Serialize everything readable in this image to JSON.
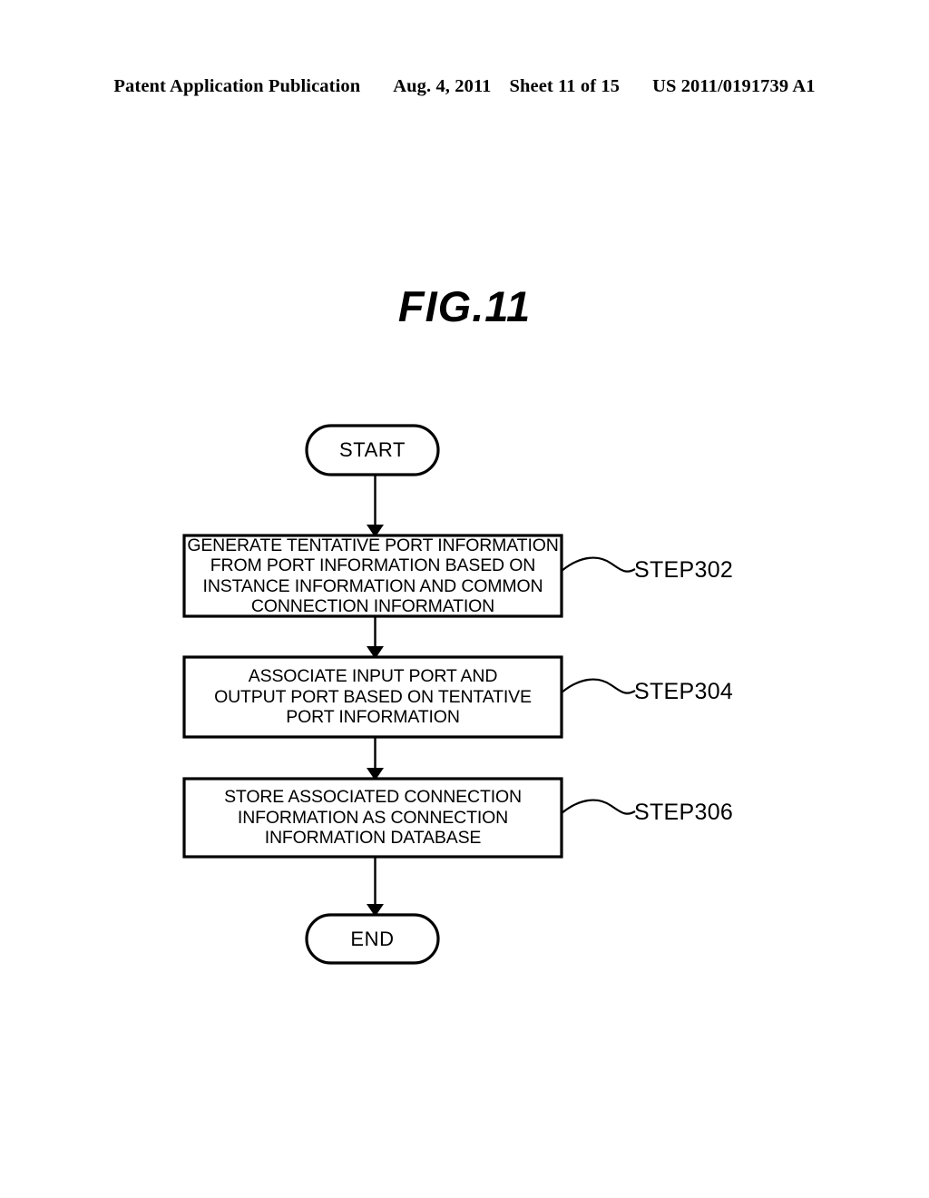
{
  "header": {
    "publication": "Patent Application Publication",
    "date": "Aug. 4, 2011",
    "sheet": "Sheet 11 of 15",
    "publication_number": "US 2011/0191739 A1"
  },
  "figure": {
    "title": "FIG.11"
  },
  "flowchart": {
    "type": "flowchart",
    "orientation": "top-to-bottom",
    "nodes": [
      {
        "id": "start",
        "shape": "terminal",
        "label": "START"
      },
      {
        "id": "step302",
        "shape": "process",
        "step": "STEP302",
        "lines": [
          "GENERATE TENTATIVE PORT INFORMATION",
          "FROM PORT INFORMATION BASED ON",
          "INSTANCE INFORMATION AND COMMON",
          "CONNECTION INFORMATION"
        ]
      },
      {
        "id": "step304",
        "shape": "process",
        "step": "STEP304",
        "lines": [
          "ASSOCIATE INPUT PORT AND",
          "OUTPUT PORT BASED ON TENTATIVE",
          "PORT INFORMATION"
        ]
      },
      {
        "id": "step306",
        "shape": "process",
        "step": "STEP306",
        "lines": [
          "STORE ASSOCIATED CONNECTION",
          "INFORMATION AS CONNECTION",
          "INFORMATION DATABASE"
        ]
      },
      {
        "id": "end",
        "shape": "terminal",
        "label": "END"
      }
    ],
    "edges": [
      {
        "from": "start",
        "to": "step302",
        "style": "arrow"
      },
      {
        "from": "step302",
        "to": "step304",
        "style": "arrow"
      },
      {
        "from": "step304",
        "to": "step306",
        "style": "arrow"
      },
      {
        "from": "step306",
        "to": "end",
        "style": "arrow"
      }
    ],
    "colors": {
      "stroke": "#000000",
      "fill": "#ffffff",
      "background": "#ffffff"
    }
  }
}
